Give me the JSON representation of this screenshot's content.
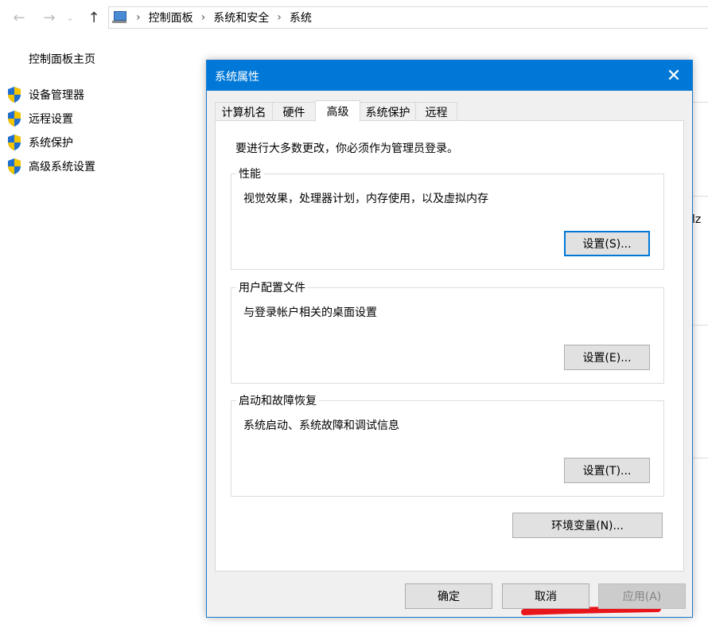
{
  "address_bar": {
    "breadcrumbs": [
      "控制面板",
      "系统和安全",
      "系统"
    ]
  },
  "left_panel": {
    "home_link": "控制面板主页",
    "tasks": [
      {
        "label": "设备管理器",
        "icon": "uac-shield-icon"
      },
      {
        "label": "远程设置",
        "icon": "uac-shield-icon"
      },
      {
        "label": "系统保护",
        "icon": "uac-shield-icon"
      },
      {
        "label": "高级系统设置",
        "icon": "uac-shield-icon"
      }
    ]
  },
  "background": {
    "right_fragment": "lz"
  },
  "dialog": {
    "title": "系统属性",
    "close_icon": "close-icon",
    "tabs": [
      {
        "label": "计算机名"
      },
      {
        "label": "硬件"
      },
      {
        "label": "高级",
        "active": true
      },
      {
        "label": "系统保护"
      },
      {
        "label": "远程"
      }
    ],
    "notice": "要进行大多数更改，你必须作为管理员登录。",
    "groups": [
      {
        "legend": "性能",
        "description": "视觉效果，处理器计划，内存使用，以及虚拟内存",
        "button": "设置(S)..."
      },
      {
        "legend": "用户配置文件",
        "description": "与登录帐户相关的桌面设置",
        "button": "设置(E)..."
      },
      {
        "legend": "启动和故障恢复",
        "description": "系统启动、系统故障和调试信息",
        "button": "设置(T)..."
      }
    ],
    "env_button": "环境变量(N)...",
    "footer": {
      "ok": "确定",
      "cancel": "取消",
      "apply": "应用(A)"
    }
  },
  "colors": {
    "title_bar": "#0078d7",
    "annotation": "#e8151b",
    "shield_blue": "#1f6fd0",
    "shield_yellow": "#f3c400"
  }
}
